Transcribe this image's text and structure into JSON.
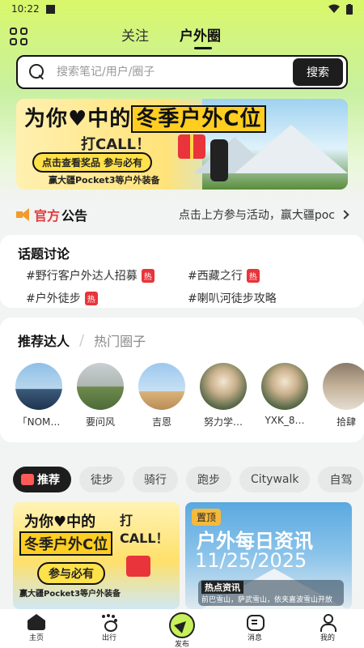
{
  "status": {
    "time": "10:22"
  },
  "nav": {
    "tabs": [
      {
        "label": "关注"
      },
      {
        "label": "户外圈"
      }
    ]
  },
  "search": {
    "placeholder": "搜索笔记/用户/圈子",
    "button": "搜索"
  },
  "banner": {
    "headline_1": "为你♥中的",
    "headline_2": "冬季户外C位",
    "call": "打CALL！",
    "sub": "点击查看奖品 参与必有",
    "small": "赢大疆Pocket3等户外装备"
  },
  "notice": {
    "title_red": "官方",
    "title_black": "公告",
    "text": "点击上方参与活动，赢大疆poc"
  },
  "topics": {
    "title": "话题讨论",
    "items": [
      {
        "label": "#野行客户外达人招募",
        "badge": "热"
      },
      {
        "label": "#西藏之行",
        "badge": "热"
      },
      {
        "label": "#户外徒步",
        "badge": "热"
      },
      {
        "label": "#喇叭河徒步攻略",
        "badge": ""
      }
    ]
  },
  "creators": {
    "tab_active": "推荐达人",
    "tab_inactive": "热门圈子",
    "people": [
      {
        "name": "「NOM…"
      },
      {
        "name": "要问风"
      },
      {
        "name": "吉恩"
      },
      {
        "name": "努力学…"
      },
      {
        "name": "YXK_8…"
      },
      {
        "name": "拾肆"
      }
    ]
  },
  "chips": [
    "推荐",
    "徒步",
    "骑行",
    "跑步",
    "Citywalk",
    "自驾"
  ],
  "feed": [
    {
      "line1": "为你♥中的",
      "line2": "冬季户外C位",
      "call": "打CALL！",
      "badge": "参与必有",
      "small": "赢大疆Pocket3等户外装备"
    },
    {
      "pin": "置顶",
      "title": "户外每日资讯",
      "date": "11/25/2025",
      "tag": "热点资讯",
      "desc": "前巴雪山，萨武雪山，依夹嘉波雪山开放"
    }
  ],
  "bottom_nav": [
    {
      "label": "主页",
      "icon": "home-icon"
    },
    {
      "label": "出行",
      "icon": "paw-icon"
    },
    {
      "label": "发布",
      "icon": "publish-icon"
    },
    {
      "label": "消息",
      "icon": "message-icon"
    },
    {
      "label": "我的",
      "icon": "profile-icon"
    }
  ]
}
